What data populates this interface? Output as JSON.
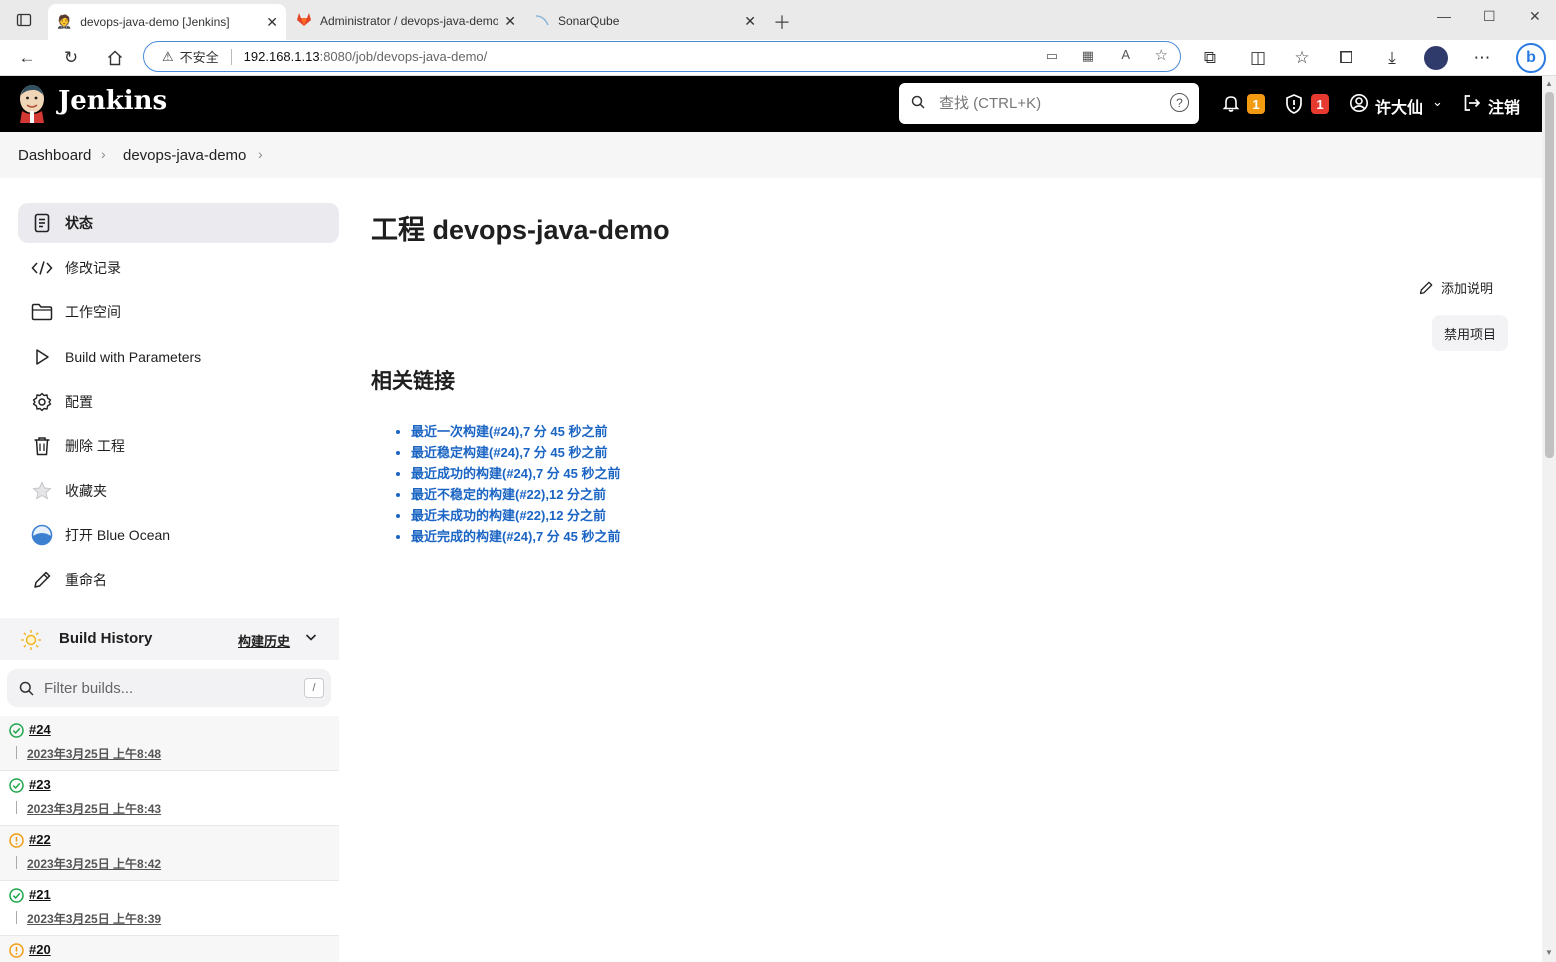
{
  "browser": {
    "tabs": [
      {
        "title": "devops-java-demo [Jenkins]",
        "active": true
      },
      {
        "title": "Administrator / devops-java-demo",
        "active": false
      },
      {
        "title": "SonarQube",
        "active": false
      }
    ],
    "address": {
      "security_label": "不安全",
      "host": "192.168.1.13",
      "path": ":8080/job/devops-java-demo/"
    }
  },
  "header": {
    "logo_text": "Jenkins",
    "search_placeholder": "查找 (CTRL+K)",
    "notifications_count": "1",
    "security_count": "1",
    "user_name": "许大仙",
    "logout_label": "注销"
  },
  "breadcrumb": {
    "items": [
      "Dashboard",
      "devops-java-demo"
    ]
  },
  "sidebar": {
    "items": [
      {
        "label": "状态",
        "icon": "document-icon",
        "active": true
      },
      {
        "label": "修改记录",
        "icon": "code-icon"
      },
      {
        "label": "工作空间",
        "icon": "folder-icon"
      },
      {
        "label": "Build with Parameters",
        "icon": "play-icon"
      },
      {
        "label": "配置",
        "icon": "gear-icon"
      },
      {
        "label": "删除 工程",
        "icon": "trash-icon"
      },
      {
        "label": "收藏夹",
        "icon": "star-icon"
      },
      {
        "label": "打开 Blue Ocean",
        "icon": "blue-ocean-icon"
      },
      {
        "label": "重命名",
        "icon": "pencil-icon"
      }
    ]
  },
  "build_history": {
    "title": "Build History",
    "trend_label": "构建历史",
    "filter_placeholder": "Filter builds...",
    "filter_shortcut": "/",
    "builds": [
      {
        "number": "#24",
        "date": "2023年3月25日 上午8:48",
        "status": "success"
      },
      {
        "number": "#23",
        "date": "2023年3月25日 上午8:43",
        "status": "success"
      },
      {
        "number": "#22",
        "date": "2023年3月25日 上午8:42",
        "status": "unstable"
      },
      {
        "number": "#21",
        "date": "2023年3月25日 上午8:39",
        "status": "success"
      },
      {
        "number": "#20",
        "date": "",
        "status": "unstable"
      }
    ]
  },
  "main": {
    "title": "工程 devops-java-demo",
    "add_description": "添加说明",
    "disable_project": "禁用项目",
    "related_title": "相关链接",
    "links": [
      "最近一次构建(#24),7 分 45 秒之前",
      "最近稳定构建(#24),7 分 45 秒之前",
      "最近成功的构建(#24),7 分 45 秒之前",
      "最近不稳定的构建(#22),12 分之前",
      "最近未成功的构建(#22),12 分之前",
      "最近完成的构建(#24),7 分 45 秒之前"
    ]
  },
  "colors": {
    "link": "#1a64c4",
    "success": "#1ea64b",
    "unstable": "#f29b11",
    "notify_badge": "#f29b11",
    "security_badge": "#e6392f"
  }
}
